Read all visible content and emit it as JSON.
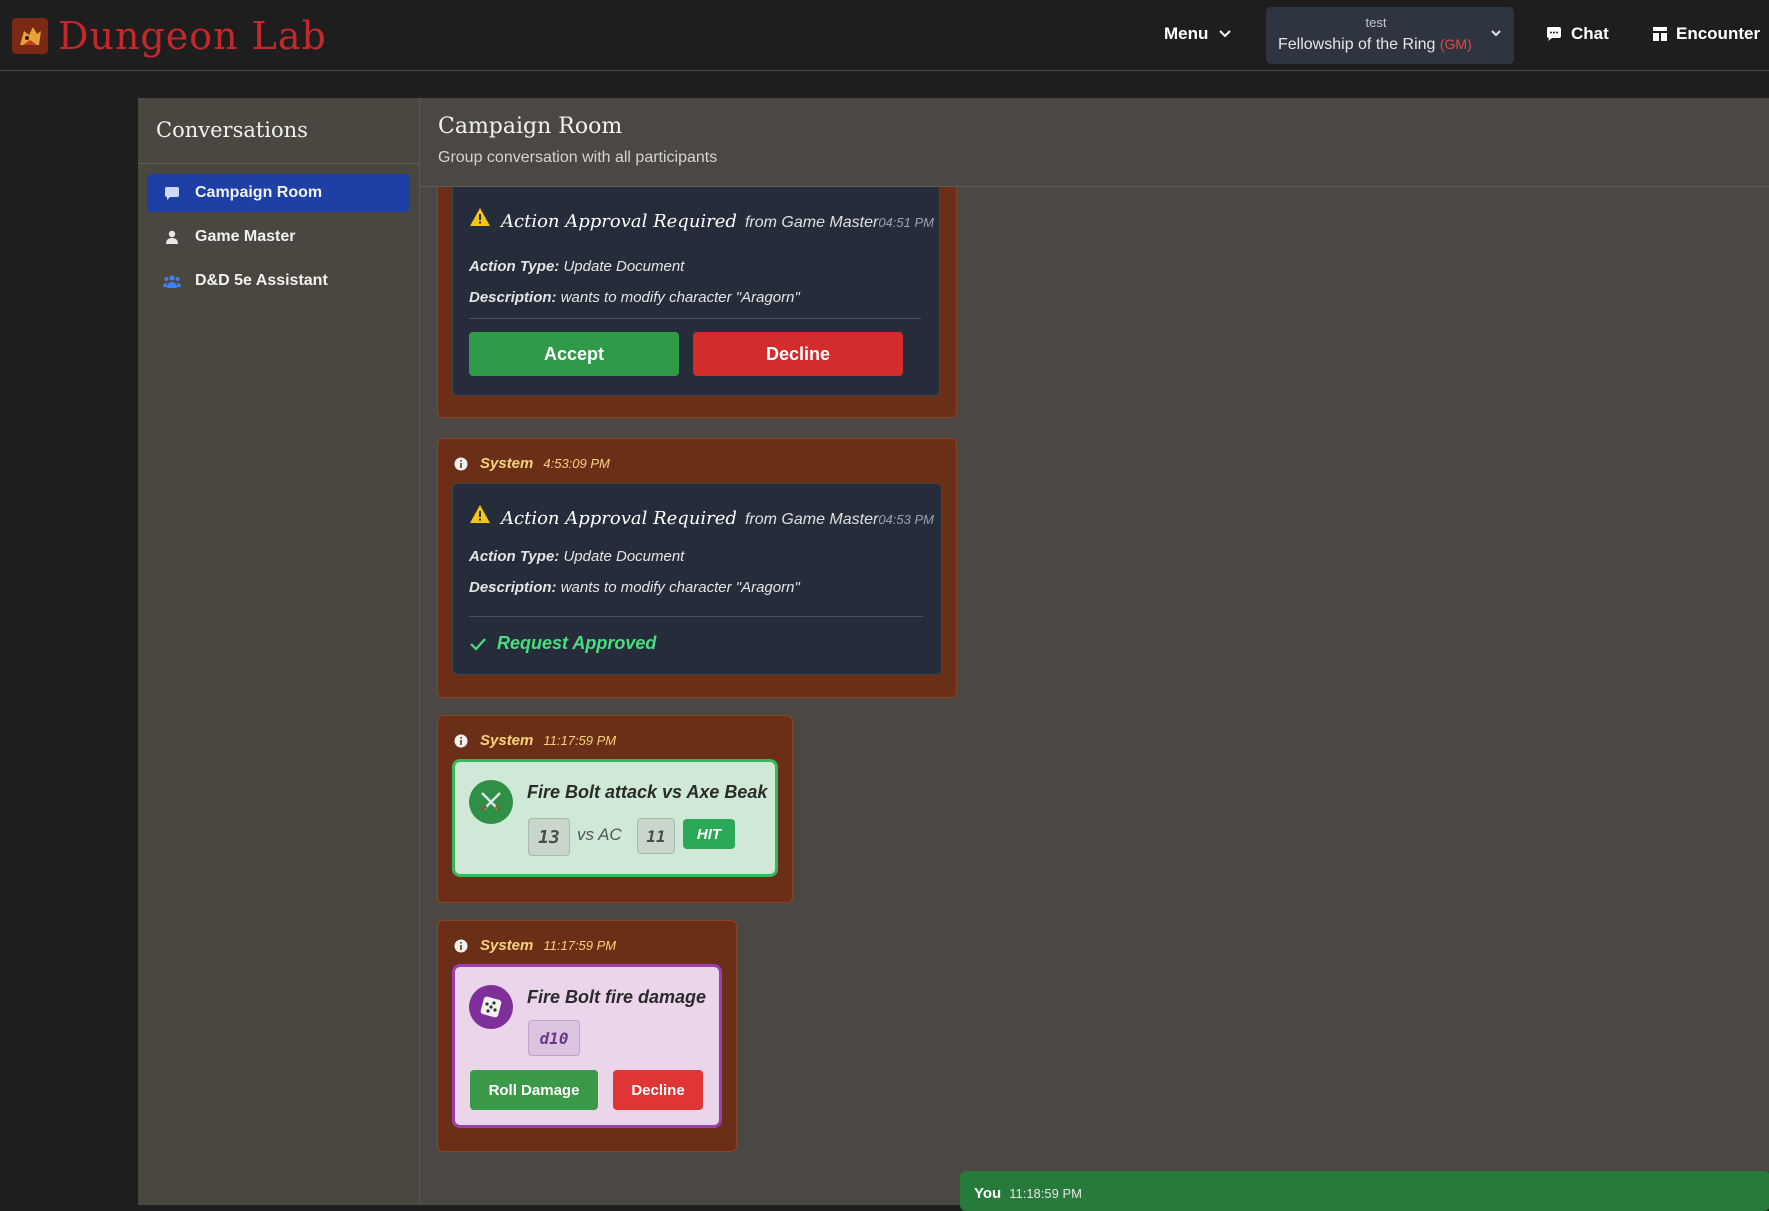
{
  "header": {
    "brand": "Dungeon Lab",
    "menu_label": "Menu",
    "campaign_label": "test",
    "campaign_name": "Fellowship of the Ring",
    "campaign_role": "(GM)",
    "chat_label": "Chat",
    "encounter_label": "Encounter"
  },
  "sidebar": {
    "title": "Conversations",
    "items": [
      {
        "label": "Campaign Room",
        "icon": "chat-bubble-icon",
        "active": true
      },
      {
        "label": "Game Master",
        "icon": "user-icon",
        "active": false
      },
      {
        "label": "D&D 5e Assistant",
        "icon": "group-icon",
        "active": false
      }
    ]
  },
  "main": {
    "title": "Campaign Room",
    "subtitle": "Group conversation with all participants"
  },
  "messages": [
    {
      "approval": {
        "title": "Action Approval Required",
        "from": "from Game Master",
        "time": "04:51 PM",
        "action_type_label": "Action Type:",
        "action_type": "Update Document",
        "description_label": "Description:",
        "description": "wants to modify character \"Aragorn\"",
        "accept_label": "Accept",
        "decline_label": "Decline"
      }
    },
    {
      "sender": "System",
      "time": "4:53:09 PM",
      "approval": {
        "title": "Action Approval Required",
        "from": "from Game Master",
        "time": "04:53 PM",
        "action_type_label": "Action Type:",
        "action_type": "Update Document",
        "description_label": "Description:",
        "description": "wants to modify character \"Aragorn\"",
        "status": "Request Approved"
      }
    },
    {
      "sender": "System",
      "time": "11:17:59 PM",
      "attack": {
        "title": "Fire Bolt attack vs Axe Beak",
        "roll": "13",
        "vs_label": "vs AC",
        "ac": "11",
        "result": "HIT"
      }
    },
    {
      "sender": "System",
      "time": "11:17:59 PM",
      "damage": {
        "title": "Fire Bolt fire damage",
        "dice": "d10",
        "roll_label": "Roll Damage",
        "decline_label": "Decline"
      }
    }
  ],
  "you_message": {
    "sender": "You",
    "time": "11:18:59 PM"
  },
  "colors": {
    "accent_blue": "#1d3fa6",
    "brand_red": "#c4282d",
    "message_bg": "#6b2f18",
    "accept_green": "#2f9a47",
    "decline_red": "#d22c2c",
    "approved_green": "#4ade80"
  }
}
